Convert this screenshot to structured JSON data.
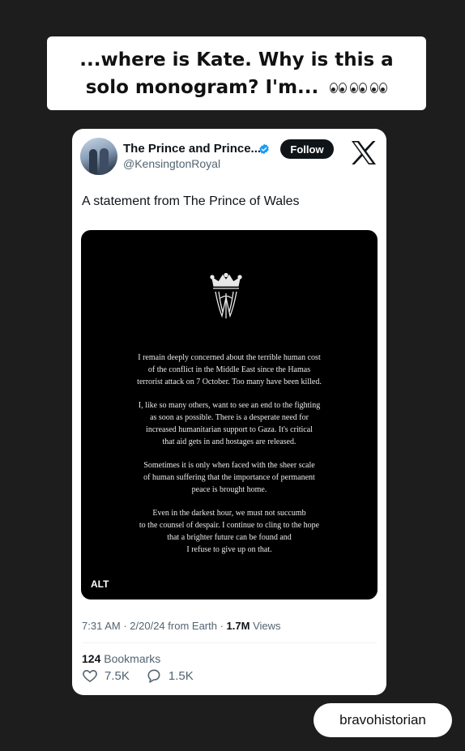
{
  "caption": {
    "line1": "...where is Kate. Why is this a",
    "line2": "solo monogram? I'm...",
    "emoji": "eyes-emoji x3"
  },
  "tweet": {
    "display_name": "The Prince and Prince...",
    "handle": "@KensingtonRoyal",
    "follow_label": "Follow",
    "text": "A statement from The Prince of Wales",
    "image": {
      "monogram": "crowned W cypher",
      "paragraphs": [
        [
          "I remain deeply concerned about the terrible human cost",
          "of the conflict in the Middle East since the Hamas",
          "terrorist attack on 7 October. Too many have been killed."
        ],
        [
          "I, like so many others, want to see an end to the fighting",
          "as soon as possible. There is a desperate need for",
          "increased humanitarian support to Gaza. It's critical",
          "that aid gets in and hostages are released."
        ],
        [
          "Sometimes it is only when faced with the sheer scale",
          "of human suffering that the importance of permanent",
          "peace is brought home."
        ],
        [
          "Even in the darkest hour, we must not succumb",
          "to the counsel of despair. I continue to cling to the hope",
          "that a brighter future can be found and",
          "I refuse to give up on that."
        ]
      ],
      "alt_label": "ALT"
    },
    "meta": {
      "time": "7:31 AM",
      "date": "2/20/24",
      "source": "from Earth",
      "views_count": "1.7M",
      "views_label": "Views"
    },
    "bookmarks_count": "124",
    "bookmarks_label": "Bookmarks",
    "likes": "7.5K",
    "replies": "1.5K"
  },
  "sticker": {
    "username": "bravohistorian"
  },
  "colors": {
    "background": "#1d1d1d",
    "verified": "#1d9bf0",
    "card": "#ffffff"
  }
}
